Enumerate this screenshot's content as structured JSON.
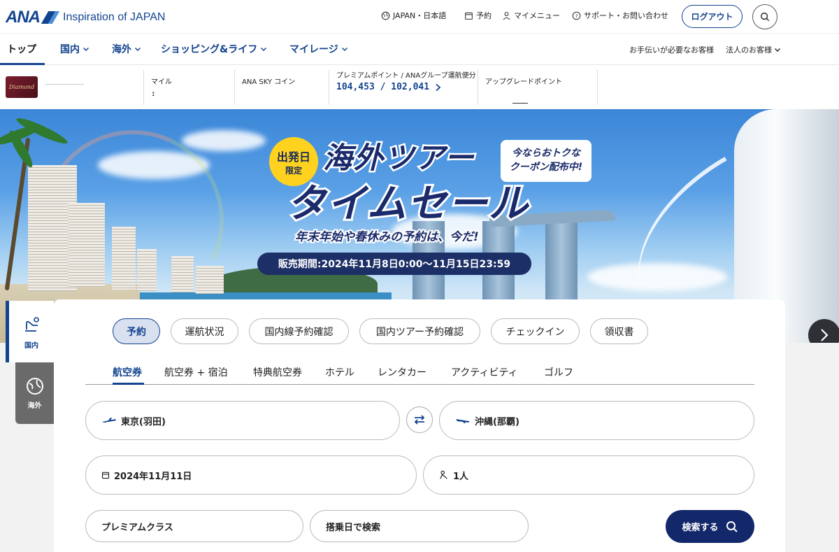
{
  "header": {
    "logo_text": "ANA",
    "tagline": "Inspiration of JAPAN",
    "region": "JAPAN・日本語",
    "reserve": "予約",
    "my_menu": "マイメニュー",
    "support": "サポート・お問い合わせ",
    "logout": "ログアウト"
  },
  "nav": {
    "items": [
      {
        "label": "トップ"
      },
      {
        "label": "国内"
      },
      {
        "label": "海外"
      },
      {
        "label": "ショッピング&ライフ"
      },
      {
        "label": "マイレージ"
      }
    ],
    "help": "お手伝いが必要なお客様",
    "corporate": "法人のお客様"
  },
  "member": {
    "card_text": "Diamond",
    "miles_label": "マイル",
    "miles_value": ":",
    "skycoin_label": "ANA SKY コイン",
    "premium_label": "プレミアムポイント / ANAグループ運航便分",
    "premium_value": "104,453 / 102,041",
    "upgrade_label": "アップグレードポイント"
  },
  "banner": {
    "badge_line1": "出発日",
    "badge_line2": "限定",
    "headline1": "海外ツアー",
    "headline2": "タイムセール",
    "coupon_line1": "今ならおトクな",
    "coupon_line2": "クーポン配布中!",
    "subcopy": "年末年始や春休みの予約は、今だ!",
    "period": "販売期間:2024年11月8日0:00〜11月15日23:59"
  },
  "side_tabs": {
    "domestic": "国内",
    "international": "海外"
  },
  "booking": {
    "pills": [
      "予約",
      "運航状況",
      "国内線予約確認",
      "国内ツアー予約確認",
      "チェックイン",
      "領収書"
    ],
    "subtabs": [
      "航空券",
      "航空券 + 宿泊",
      "特典航空券",
      "ホテル",
      "レンタカー",
      "アクティビティ",
      "ゴルフ"
    ],
    "from": "東京(羽田)",
    "to": "沖縄(那覇)",
    "date": "2024年11月11日",
    "passengers": "1人",
    "class": "プレミアムクラス",
    "search_mode": "搭乗日で検索",
    "search_button": "検索する"
  },
  "colors": {
    "brand": "#13448f",
    "search_button": "#13276b",
    "badge_yellow": "#ffd21f"
  }
}
